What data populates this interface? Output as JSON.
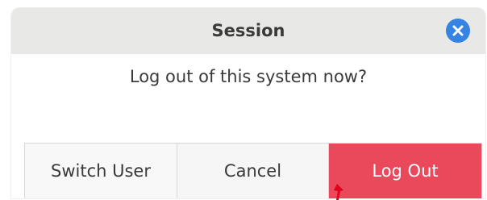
{
  "dialog": {
    "title": "Session",
    "message": "Log out of this system now?",
    "close_icon": "close-icon",
    "buttons": {
      "switch_user": "Switch User",
      "cancel": "Cancel",
      "log_out": "Log Out"
    }
  },
  "colors": {
    "accent_blue": "#3584e4",
    "destructive_red": "#e9495a",
    "cursor_red": "#e0001b"
  }
}
